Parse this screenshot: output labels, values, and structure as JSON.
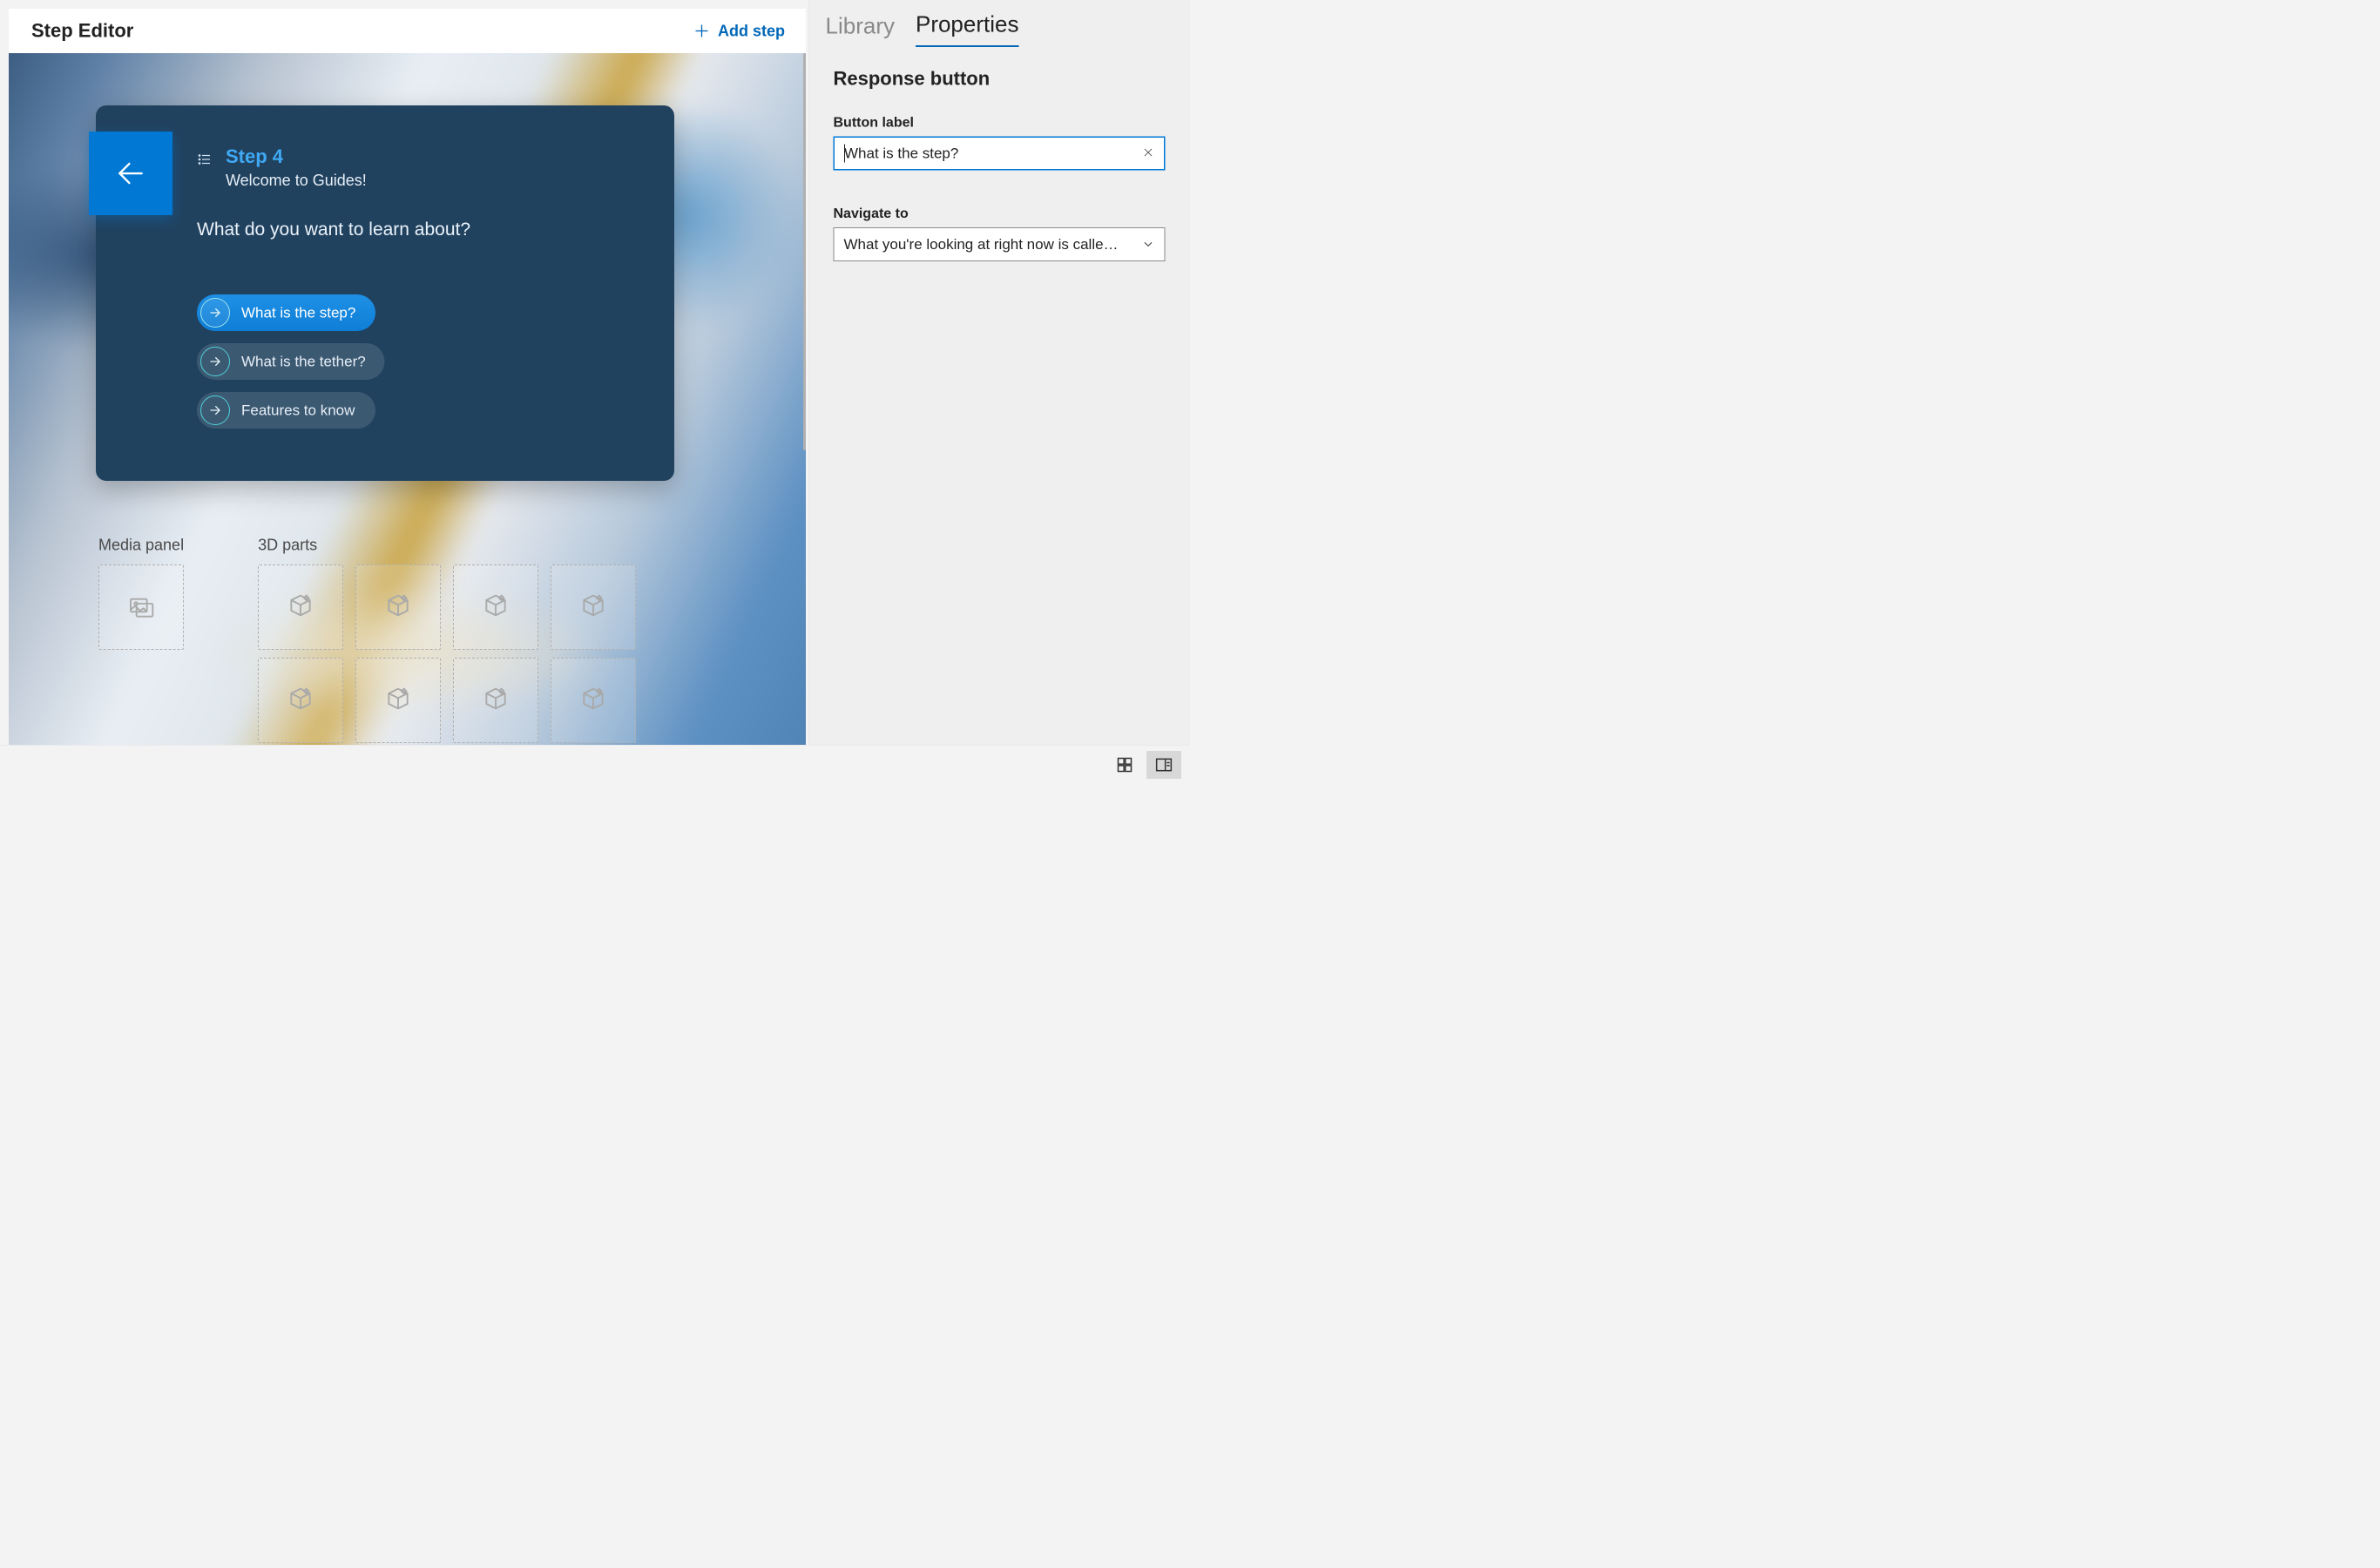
{
  "header": {
    "title": "Step Editor",
    "add_step_label": "Add step"
  },
  "card": {
    "step_title": "Step 4",
    "subtitle": "Welcome to Guides!",
    "prompt": "What do you want to learn about?",
    "responses": [
      {
        "label": "What is the step?",
        "selected": true
      },
      {
        "label": "What is the tether?",
        "selected": false
      },
      {
        "label": "Features to know",
        "selected": false
      }
    ]
  },
  "panels": {
    "media_label": "Media panel",
    "parts_label": "3D parts"
  },
  "side": {
    "tabs": {
      "library": "Library",
      "properties": "Properties",
      "active": "properties"
    },
    "section_title": "Response button",
    "button_label_field": "Button label",
    "button_label_value": "What is the step?",
    "navigate_label": "Navigate to",
    "navigate_value": "What you're looking at right now is calle…"
  }
}
